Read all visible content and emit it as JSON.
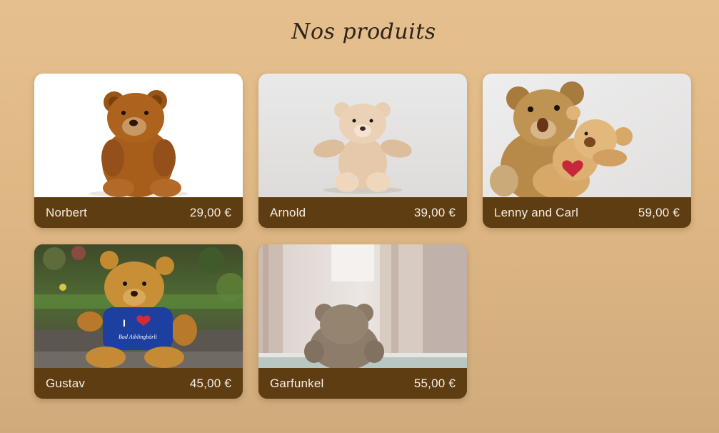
{
  "page": {
    "title": "Nos produits"
  },
  "colors": {
    "background_top": "#e5c08e",
    "background_bottom": "#cfab7c",
    "caption_bar": "#5e3d12",
    "caption_text": "#f4ede3"
  },
  "products": [
    {
      "name": "Norbert",
      "price": "29,00 €",
      "image": "brown-teddy-bear-white-background"
    },
    {
      "name": "Arnold",
      "price": "39,00 €",
      "image": "beige-teddy-bear-grey-background"
    },
    {
      "name": "Lenny and Carl",
      "price": "59,00 €",
      "image": "two-teddy-bears-hugging"
    },
    {
      "name": "Gustav",
      "price": "45,00 €",
      "image": "teddy-bear-blue-shirt-garden"
    },
    {
      "name": "Garfunkel",
      "price": "55,00 €",
      "image": "teddy-bear-back-window"
    }
  ]
}
